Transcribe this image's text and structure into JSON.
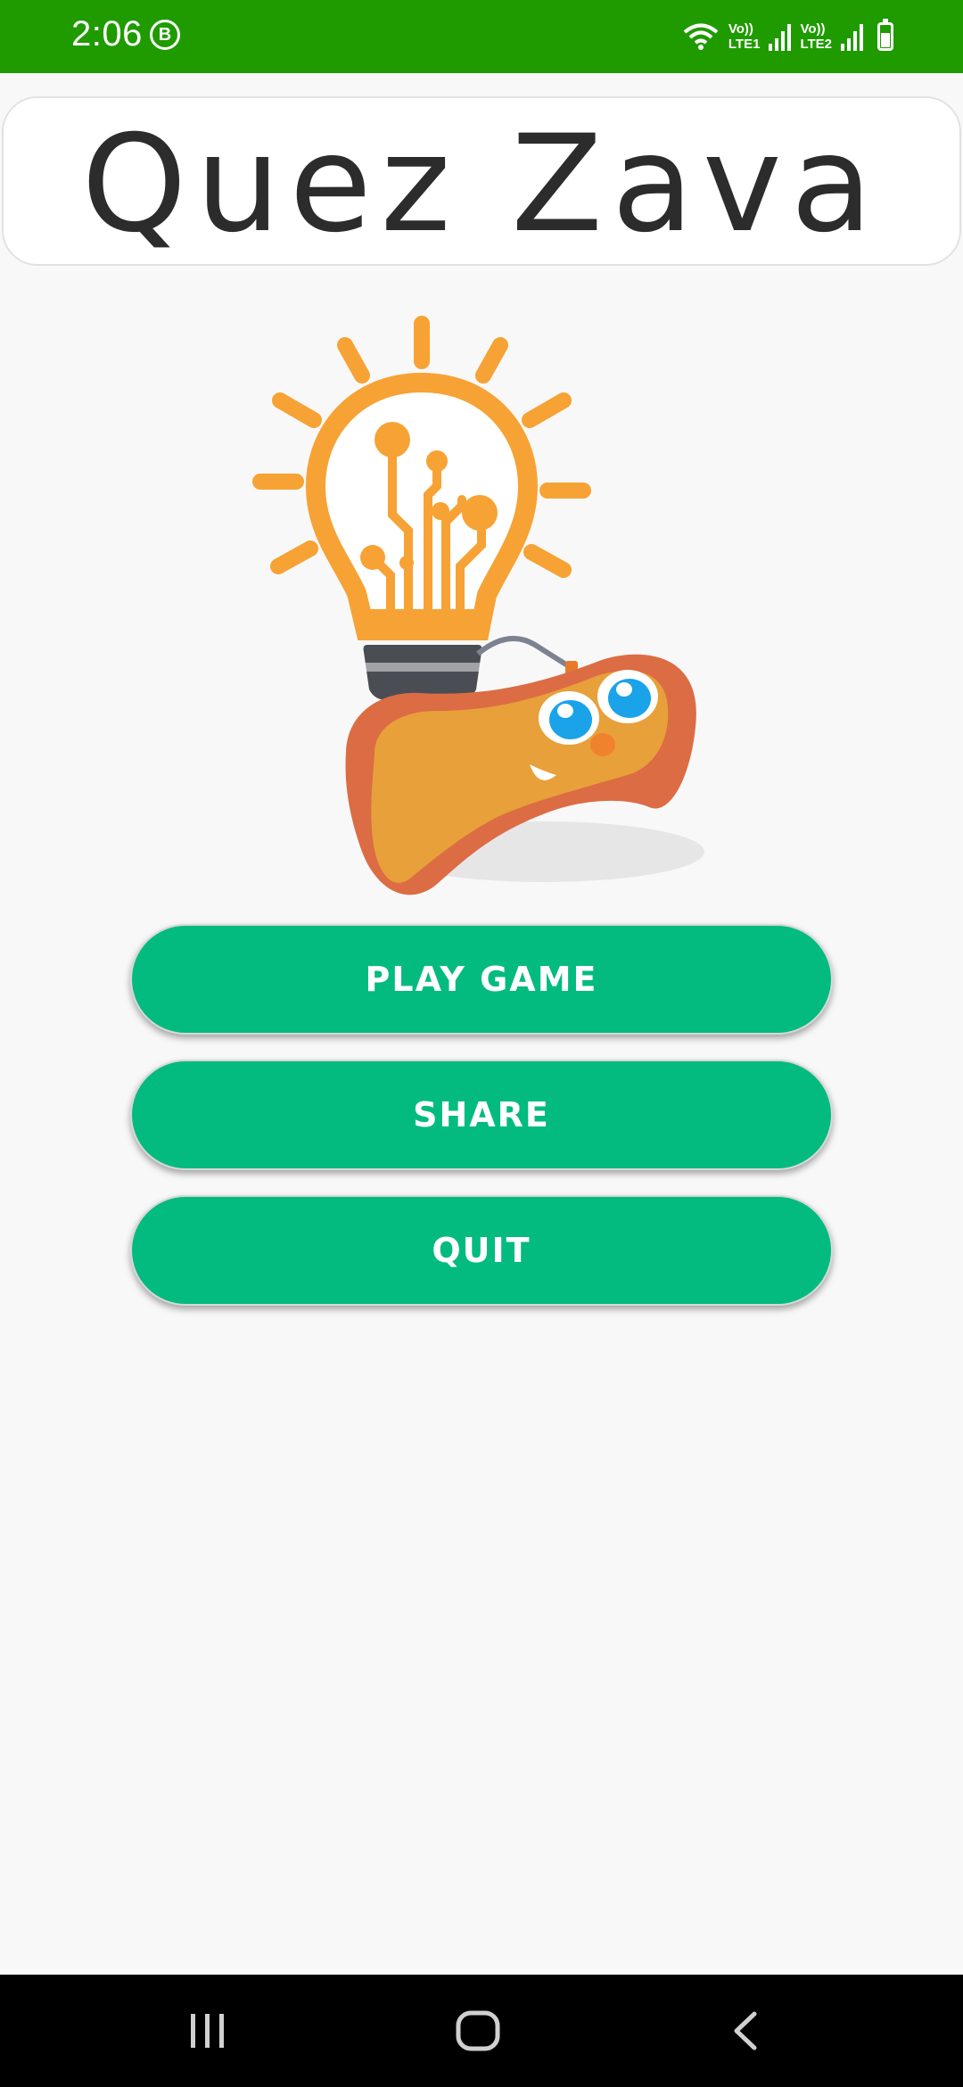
{
  "status_bar": {
    "time": "2:06",
    "b_badge": "B",
    "sim1": {
      "volte": "Vo))",
      "lte": "LTE1"
    },
    "sim2": {
      "volte": "Vo))",
      "lte": "LTE2"
    },
    "background": "#1f9b00"
  },
  "header": {
    "title": "Quez Zava"
  },
  "logo": {
    "icon": "lightbulb-gamepad-logo"
  },
  "menu": {
    "play_label": "PLAY GAME",
    "share_label": "SHARE",
    "quit_label": "QUIT",
    "button_color": "#03bb7f"
  },
  "nav_bar": {
    "icons": [
      "recent-apps-icon",
      "home-icon",
      "back-icon"
    ]
  }
}
